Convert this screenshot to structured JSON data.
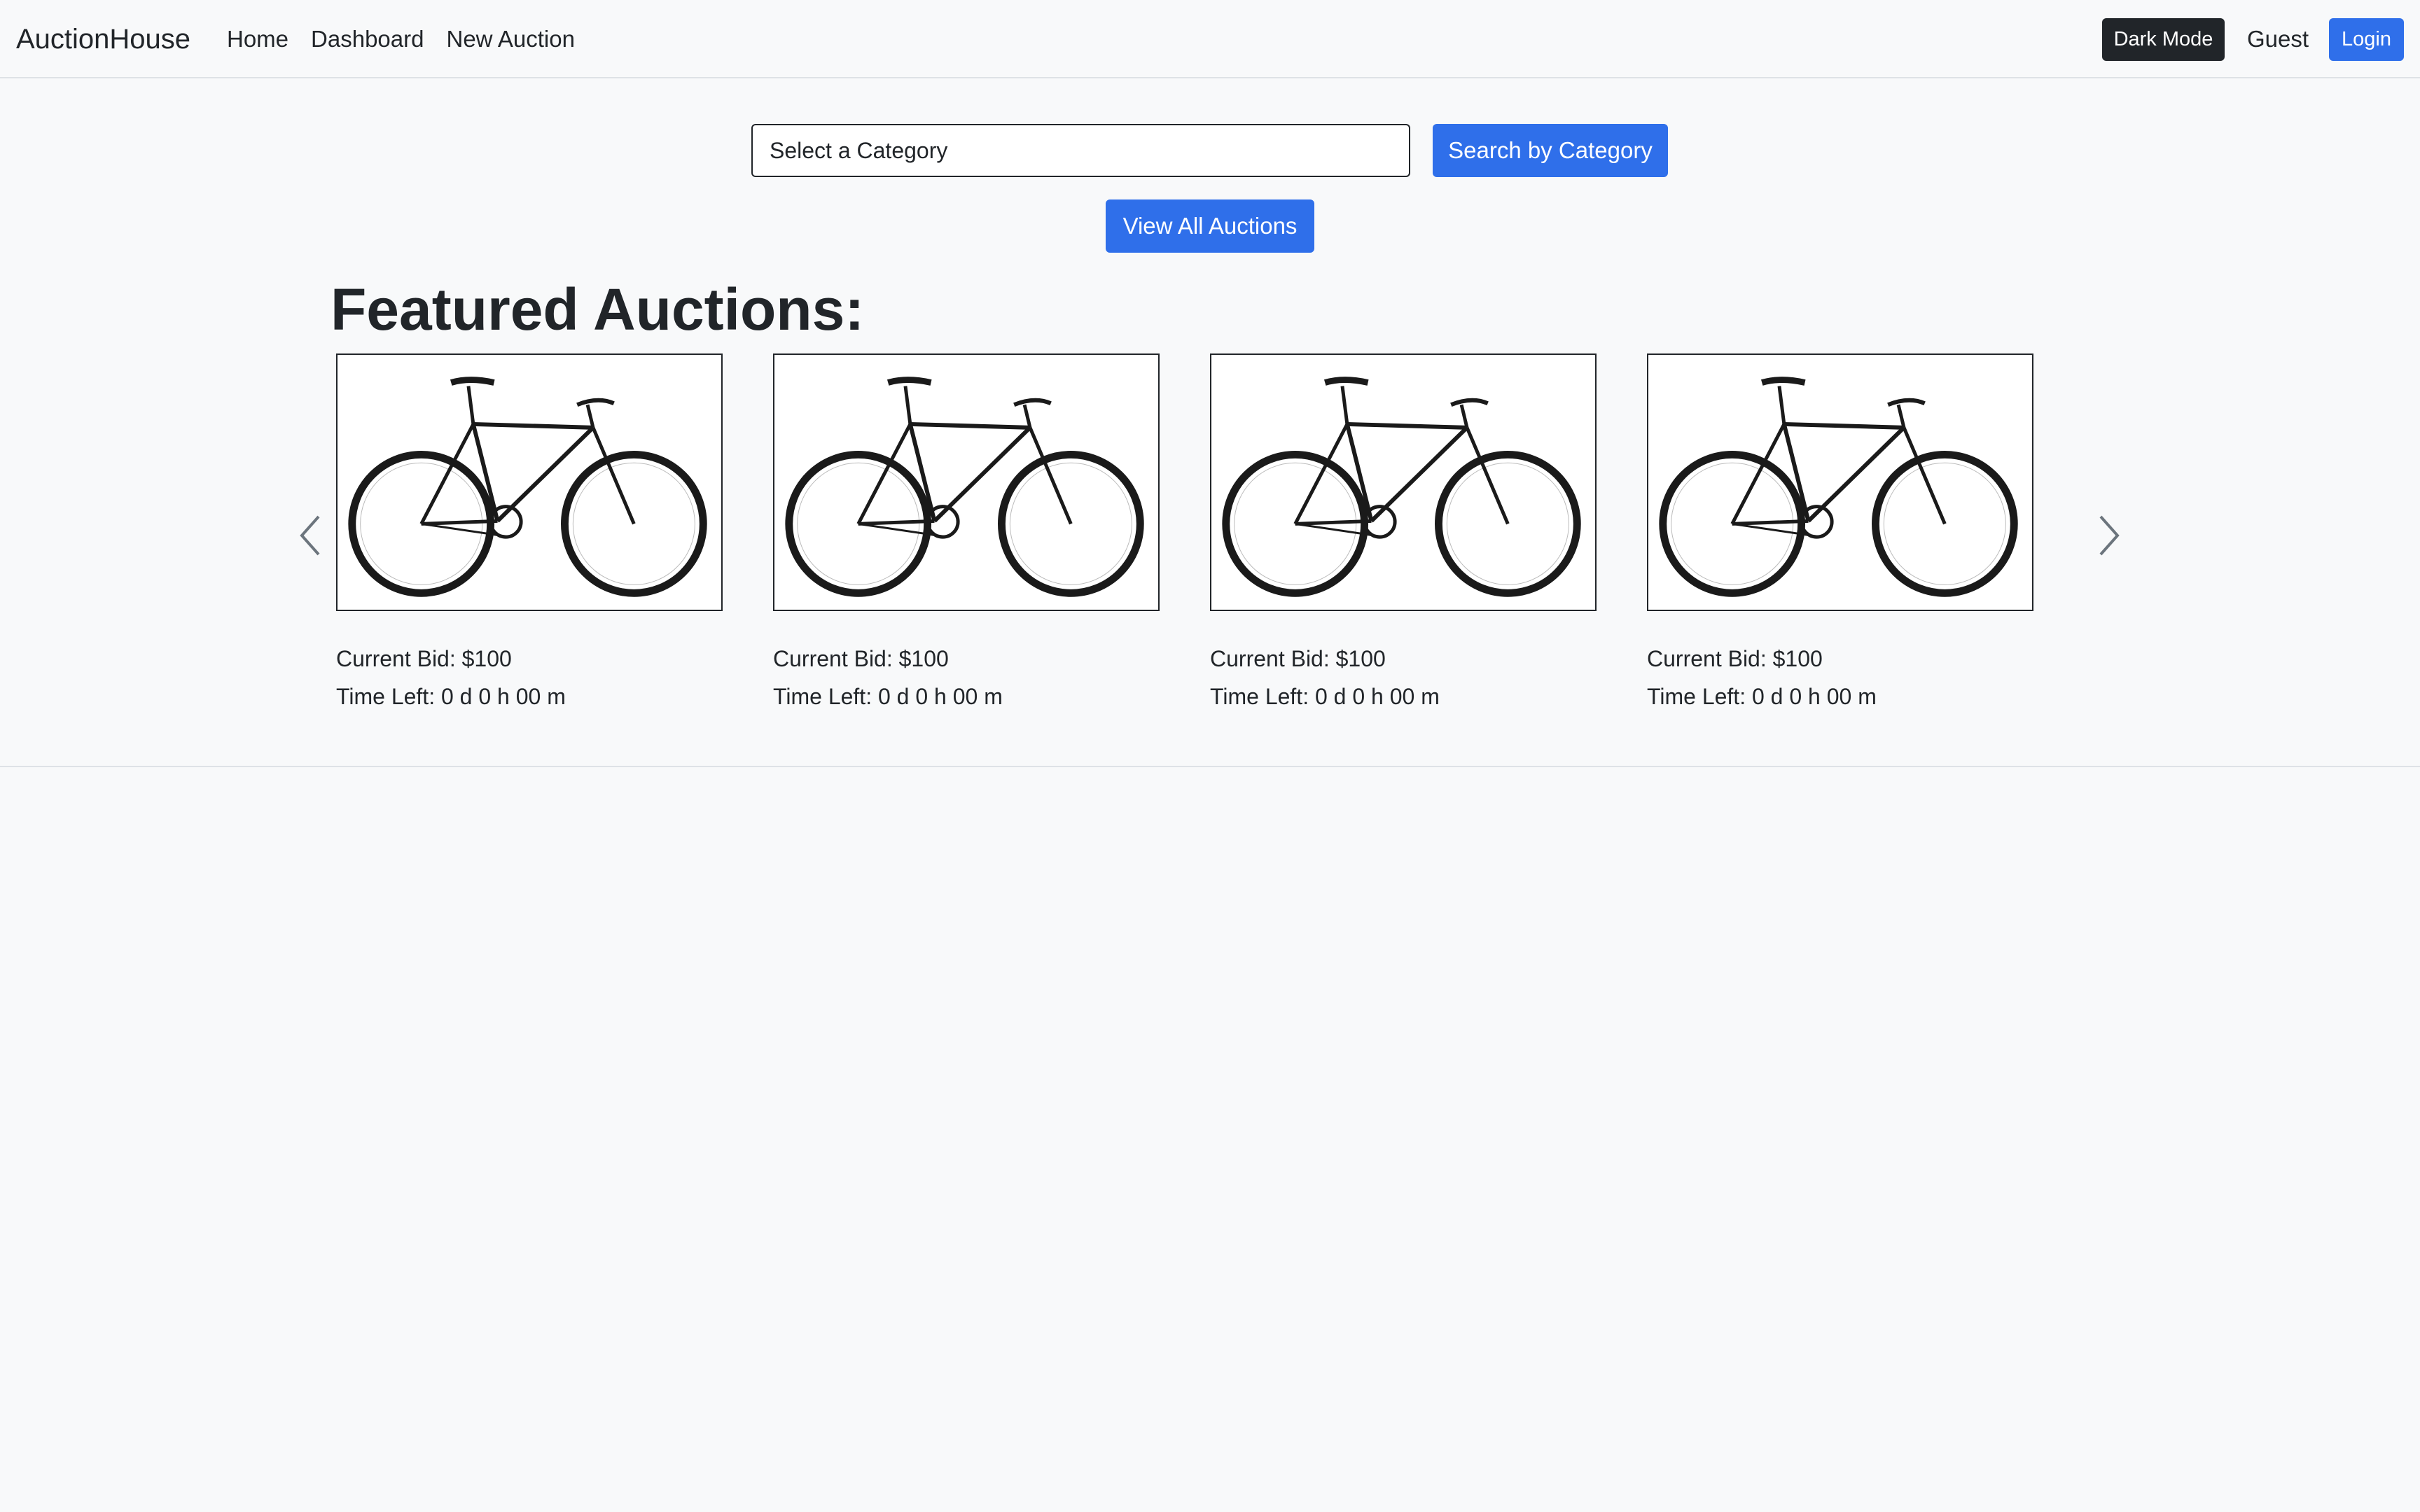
{
  "navbar": {
    "brand": "AuctionHouse",
    "links": [
      "Home",
      "Dashboard",
      "New Auction"
    ],
    "dark_mode_label": "Dark Mode",
    "user_label": "Guest",
    "login_label": "Login"
  },
  "search": {
    "category_select_value": "Select a Category",
    "search_button_label": "Search by Category",
    "view_all_label": "View All Auctions"
  },
  "featured": {
    "title": "Featured Auctions:",
    "items": [
      {
        "bid": "Current Bid: $100",
        "time_left": "Time Left: 0 d 0 h 00 m",
        "image": "bicycle"
      },
      {
        "bid": "Current Bid: $100",
        "time_left": "Time Left: 0 d 0 h 00 m",
        "image": "bicycle"
      },
      {
        "bid": "Current Bid: $100",
        "time_left": "Time Left: 0 d 0 h 00 m",
        "image": "bicycle"
      },
      {
        "bid": "Current Bid: $100",
        "time_left": "Time Left: 0 d 0 h 00 m",
        "image": "bicycle"
      }
    ],
    "prev_icon": "chevron-left-icon",
    "next_icon": "chevron-right-icon"
  },
  "colors": {
    "primary": "#2f6fea",
    "dark": "#212529",
    "background": "#f8f9fa"
  }
}
